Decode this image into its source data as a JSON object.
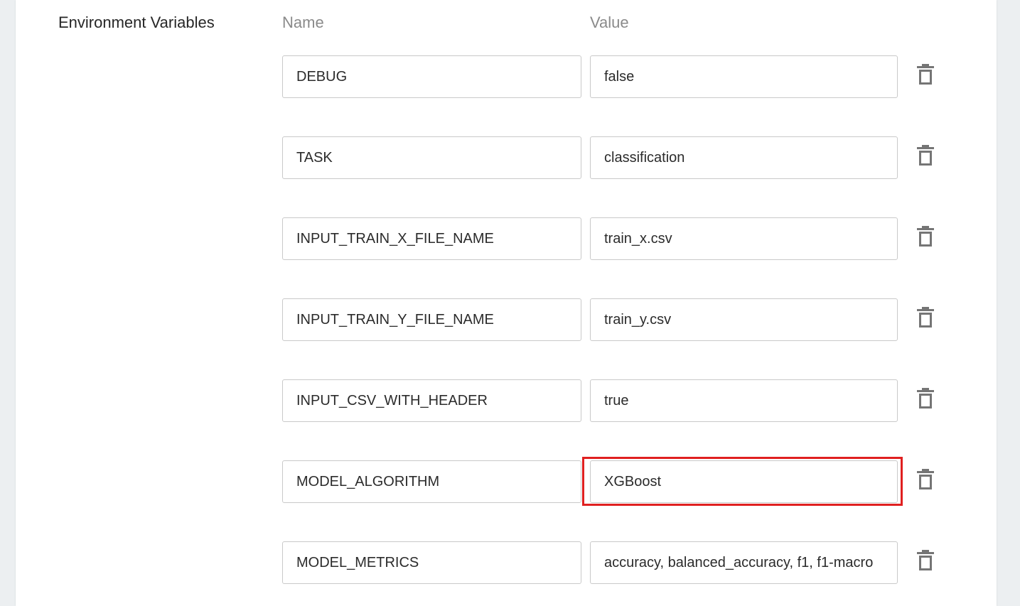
{
  "section": {
    "label": "Environment Variables",
    "name_header": "Name",
    "value_header": "Value"
  },
  "env_vars": [
    {
      "name": "DEBUG",
      "value": "false"
    },
    {
      "name": "TASK",
      "value": "classification"
    },
    {
      "name": "INPUT_TRAIN_X_FILE_NAME",
      "value": "train_x.csv"
    },
    {
      "name": "INPUT_TRAIN_Y_FILE_NAME",
      "value": "train_y.csv"
    },
    {
      "name": "INPUT_CSV_WITH_HEADER",
      "value": "true"
    },
    {
      "name": "MODEL_ALGORITHM",
      "value": "XGBoost"
    },
    {
      "name": "MODEL_METRICS",
      "value": "accuracy, balanced_accuracy, f1, f1-macro"
    }
  ],
  "icons": {
    "delete": "trash-icon"
  },
  "colors": {
    "highlight": "#e02020",
    "header_text": "#8a8a8a",
    "border": "#c9c9c9",
    "page_bg": "#eceff1"
  }
}
